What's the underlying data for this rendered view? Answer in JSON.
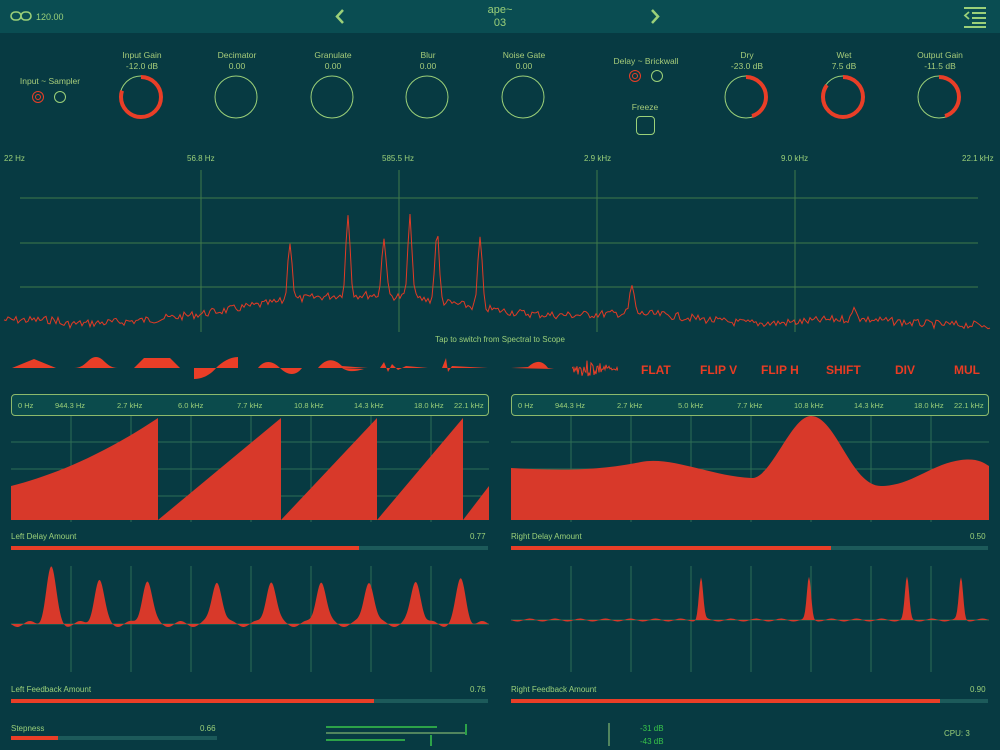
{
  "header": {
    "tempo": "120.00",
    "preset_name": "ape~",
    "preset_number": "03"
  },
  "controls": {
    "input_mode_label": "Input ~ Sampler",
    "delay_mode_label": "Delay ~ Brickwall",
    "freeze_label": "Freeze",
    "knobs": [
      {
        "id": "input-gain",
        "label": "Input Gain",
        "value": "-12.0 dB",
        "fill": 0.8
      },
      {
        "id": "decimator",
        "label": "Decimator",
        "value": "0.00",
        "fill": 0
      },
      {
        "id": "granulate",
        "label": "Granulate",
        "value": "0.00",
        "fill": 0
      },
      {
        "id": "blur",
        "label": "Blur",
        "value": "0.00",
        "fill": 0
      },
      {
        "id": "noise-gate",
        "label": "Noise Gate",
        "value": "0.00",
        "fill": 0
      },
      {
        "id": "dry",
        "label": "Dry",
        "value": "-23.0 dB",
        "fill": 0.45
      },
      {
        "id": "wet",
        "label": "Wet",
        "value": "7.5 dB",
        "fill": 0.85
      },
      {
        "id": "output-gain",
        "label": "Output Gain",
        "value": "-11.5 dB",
        "fill": 0.45
      }
    ]
  },
  "spectrum": {
    "freq_labels": [
      "22 Hz",
      "56.8 Hz",
      "585.5 Hz",
      "2.9 kHz",
      "9.0 kHz",
      "22.1 kHz"
    ],
    "hint": "Tap to switch from Spectral to Scope"
  },
  "shape_buttons": [
    "FLAT",
    "FLIP V",
    "FLIP H",
    "SHIFT",
    "DIV",
    "MUL"
  ],
  "freq_axis": [
    "0 Hz",
    "944.3 Hz",
    "2.7 kHz",
    "6.0 kHz",
    "7.7 kHz",
    "10.8 kHz",
    "14.3 kHz",
    "18.0 kHz",
    "22.1 kHz"
  ],
  "freq_axis_right": [
    "0 Hz",
    "944.3 Hz",
    "2.7 kHz",
    "5.0 kHz",
    "7.7 kHz",
    "10.8 kHz",
    "14.3 kHz",
    "18.0 kHz",
    "22.1 kHz"
  ],
  "sliders": {
    "left_delay": {
      "label": "Left Delay Amount",
      "value": "0.77",
      "fraction": 0.73
    },
    "right_delay": {
      "label": "Right Delay Amount",
      "value": "0.50",
      "fraction": 0.67
    },
    "left_feedback": {
      "label": "Left Feedback Amount",
      "value": "0.76",
      "fraction": 0.76
    },
    "right_feedback": {
      "label": "Right Feedback Amount",
      "value": "0.90",
      "fraction": 0.9
    },
    "stepness": {
      "label": "Stepness",
      "value": "0.66",
      "fraction": 0.23
    }
  },
  "meters": {
    "top_db": "-31 dB",
    "bottom_db": "-43 dB"
  },
  "cpu": "CPU: 3",
  "colors": {
    "background": "#073a42",
    "accent": "#ea3c23",
    "text": "#9bd079"
  }
}
